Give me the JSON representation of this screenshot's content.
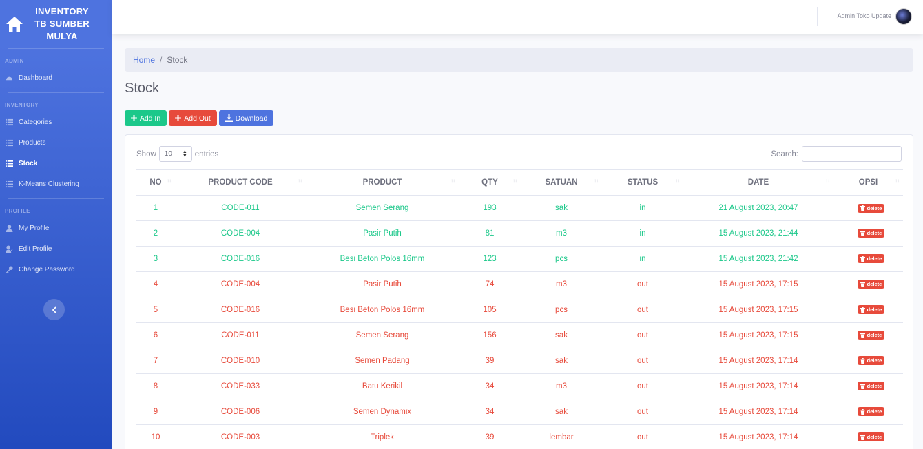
{
  "sidebar": {
    "brand": "INVENTORY TB SUMBER MULYA",
    "sections": [
      {
        "heading": "ADMIN",
        "items": [
          {
            "label": "Dashboard",
            "icon": "dashboard-icon"
          }
        ]
      },
      {
        "heading": "INVENTORY",
        "items": [
          {
            "label": "Categories",
            "icon": "list-icon"
          },
          {
            "label": "Products",
            "icon": "list-icon"
          },
          {
            "label": "Stock",
            "icon": "list-icon",
            "active": true
          },
          {
            "label": "K-Means Clustering",
            "icon": "list-icon"
          }
        ]
      },
      {
        "heading": "PROFILE",
        "items": [
          {
            "label": "My Profile",
            "icon": "user-icon"
          },
          {
            "label": "Edit Profile",
            "icon": "user-edit-icon"
          },
          {
            "label": "Change Password",
            "icon": "key-icon"
          }
        ]
      }
    ]
  },
  "topbar": {
    "user_name": "Admin Toko Update"
  },
  "breadcrumb": {
    "home": "Home",
    "separator": "/",
    "current": "Stock"
  },
  "page": {
    "title": "Stock"
  },
  "buttons": {
    "add_in": "Add In",
    "add_out": "Add Out",
    "download": "Download"
  },
  "table_controls": {
    "show_label": "Show",
    "entries_value": "10",
    "entries_label": "entries",
    "search_label": "Search:"
  },
  "table": {
    "headers": [
      "NO",
      "PRODUCT CODE",
      "PRODUCT",
      "QTY",
      "SATUAN",
      "STATUS",
      "DATE",
      "OPSI"
    ],
    "delete_label": "delete",
    "rows": [
      {
        "no": "1",
        "code": "CODE-011",
        "product": "Semen Serang",
        "qty": "193",
        "satuan": "sak",
        "status": "in",
        "date": "21 August 2023, 20:47"
      },
      {
        "no": "2",
        "code": "CODE-004",
        "product": "Pasir Putih",
        "qty": "81",
        "satuan": "m3",
        "status": "in",
        "date": "15 August 2023, 21:44"
      },
      {
        "no": "3",
        "code": "CODE-016",
        "product": "Besi Beton Polos 16mm",
        "qty": "123",
        "satuan": "pcs",
        "status": "in",
        "date": "15 August 2023, 21:42"
      },
      {
        "no": "4",
        "code": "CODE-004",
        "product": "Pasir Putih",
        "qty": "74",
        "satuan": "m3",
        "status": "out",
        "date": "15 August 2023, 17:15"
      },
      {
        "no": "5",
        "code": "CODE-016",
        "product": "Besi Beton Polos 16mm",
        "qty": "105",
        "satuan": "pcs",
        "status": "out",
        "date": "15 August 2023, 17:15"
      },
      {
        "no": "6",
        "code": "CODE-011",
        "product": "Semen Serang",
        "qty": "156",
        "satuan": "sak",
        "status": "out",
        "date": "15 August 2023, 17:15"
      },
      {
        "no": "7",
        "code": "CODE-010",
        "product": "Semen Padang",
        "qty": "39",
        "satuan": "sak",
        "status": "out",
        "date": "15 August 2023, 17:14"
      },
      {
        "no": "8",
        "code": "CODE-033",
        "product": "Batu Kerikil",
        "qty": "34",
        "satuan": "m3",
        "status": "out",
        "date": "15 August 2023, 17:14"
      },
      {
        "no": "9",
        "code": "CODE-006",
        "product": "Semen Dynamix",
        "qty": "34",
        "satuan": "sak",
        "status": "out",
        "date": "15 August 2023, 17:14"
      },
      {
        "no": "10",
        "code": "CODE-003",
        "product": "Triplek",
        "qty": "39",
        "satuan": "lembar",
        "status": "out",
        "date": "15 August 2023, 17:14"
      }
    ]
  },
  "colors": {
    "primary": "#4e73df",
    "success": "#1cc88a",
    "danger": "#e74a3b"
  }
}
